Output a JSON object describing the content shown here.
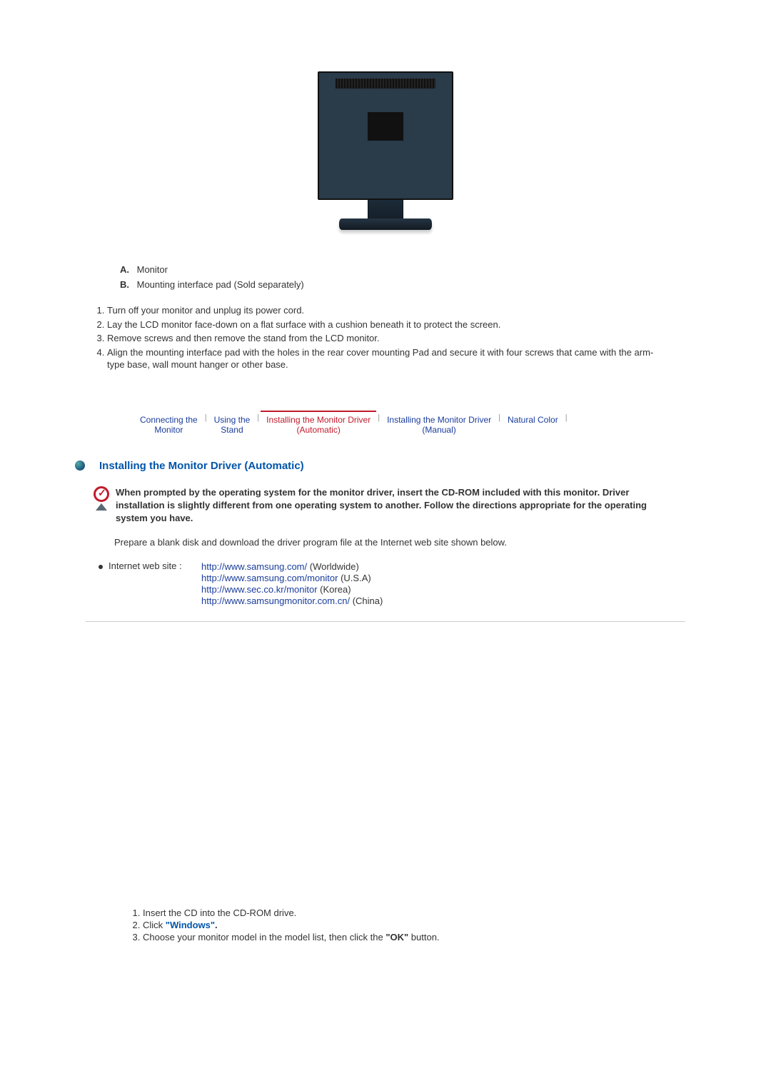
{
  "labels": {
    "A": {
      "letter": "A.",
      "text": "Monitor"
    },
    "B": {
      "letter": "B.",
      "text": "Mounting interface pad (Sold separately)"
    }
  },
  "steps": [
    "Turn off your monitor and unplug its power cord.",
    "Lay the LCD monitor face-down on a flat surface with a cushion beneath it to protect the screen.",
    "Remove screws and then remove the stand from the LCD monitor.",
    "Align the mounting interface pad with the holes in the rear cover mounting Pad and secure it with four screws that came with the arm-type base, wall mount hanger or other base."
  ],
  "tabs": {
    "connecting": "Connecting the\nMonitor",
    "using": "Using the\nStand",
    "auto": "Installing the Monitor Driver\n(Automatic)",
    "manual": "Installing the Monitor Driver\n(Manual)",
    "natural": "Natural Color"
  },
  "section_title": "Installing the Monitor Driver (Automatic)",
  "note": "When prompted by the operating system for the monitor driver, insert the CD-ROM included with this monitor. Driver installation is slightly different from one operating system to another. Follow the directions appropriate for the operating system you have.",
  "prepare": "Prepare a blank disk and download the driver program file at the Internet web site shown below.",
  "web": {
    "label": "Internet web site :",
    "rows": [
      {
        "url": "http://www.samsung.com/",
        "suffix": " (Worldwide)"
      },
      {
        "url": "http://www.samsung.com/monitor",
        "suffix": " (U.S.A)"
      },
      {
        "url": "http://www.sec.co.kr/monitor",
        "suffix": " (Korea)"
      },
      {
        "url": "http://www.samsungmonitor.com.cn/",
        "suffix": " (China)"
      }
    ]
  },
  "install": {
    "s1": "Insert the CD into the CD-ROM drive.",
    "s2_a": "Click ",
    "s2_b": "\"Windows\"",
    "s2_c": ".",
    "s3_a": "Choose your monitor model in the model list, then click the ",
    "s3_b": "\"OK\"",
    "s3_c": " button."
  }
}
